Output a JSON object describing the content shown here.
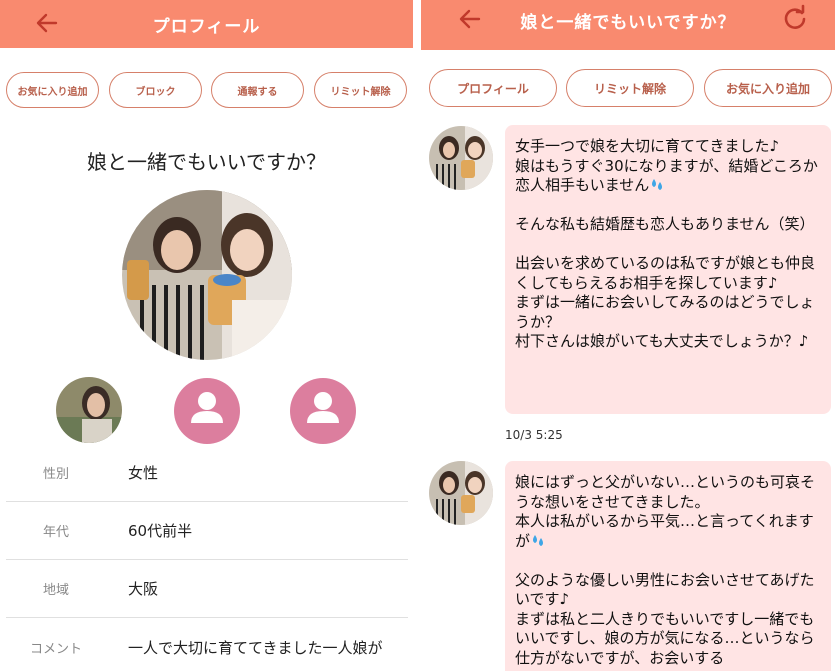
{
  "left": {
    "header": {
      "title": "プロフィール",
      "back_icon": "back-arrow-icon"
    },
    "buttons": [
      "お気に入り追加",
      "ブロック",
      "通報する",
      "リミット解除"
    ],
    "profile_title": "娘と一緒でもいいですか？",
    "info": [
      {
        "label": "性別",
        "value": "女性"
      },
      {
        "label": "年代",
        "value": "60代前半"
      },
      {
        "label": "地域",
        "value": "大阪"
      },
      {
        "label": "コメント",
        "value": "一人で大切に育ててきました一人娘が"
      }
    ]
  },
  "right": {
    "header": {
      "title": "娘と一緒でもいいですか？",
      "back_icon": "back-arrow-icon",
      "refresh_icon": "refresh-icon"
    },
    "buttons": [
      "プロフィール",
      "リミット解除",
      "お気に入り追加"
    ],
    "messages": [
      {
        "lines": [
          "女手一つで娘を大切に育ててきました♪",
          "娘はもうすぐ30になりますが、結婚どころか恋人相手もいません",
          "",
          "そんな私も結婚歴も恋人もありません（笑）",
          "",
          "出会いを求めているのは私ですが娘とも仲良くしてもらえるお相手を探しています♪",
          "まずは一緒にお会いしてみるのはどうでしょうか？",
          "村下さんは娘がいても大丈夫でしょうか？♪"
        ],
        "timestamp": "10/3 5:25"
      },
      {
        "lines": [
          "娘にはずっと父がいない…というのも可哀そうな想いをさせてきました。",
          "本人は私がいるから平気…と言ってくれますが",
          "",
          "父のような優しい男性にお会いさせてあげたいです♪",
          "まずは私と二人きりでもいいですし一緒でもいいですし、娘の方が気になる…というなら仕方がないですが、お会いする"
        ]
      }
    ]
  },
  "colors": {
    "header": "#f98a6f",
    "pill_border": "#d6806a",
    "pill_text": "#b8604c",
    "bubble": "#ffe4e4",
    "placeholder": "#dc7e9e"
  }
}
